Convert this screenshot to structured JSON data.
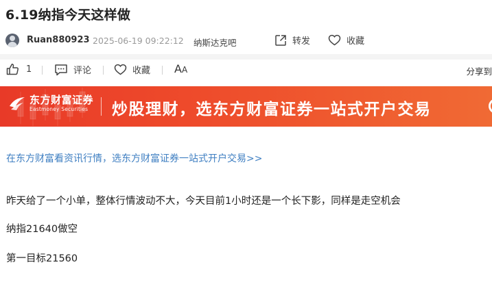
{
  "article": {
    "title": "6.19纳指今天这样做",
    "username": "Ruan880923",
    "datetime": "2025-06-19 09:22:12",
    "forum": "纳斯达克吧",
    "forward_label": "转发",
    "favorite_label": "收藏"
  },
  "toolbar": {
    "like_count": "1",
    "comment_label": "评论",
    "favorite_label": "收藏",
    "font_big": "A",
    "font_small": "A",
    "share_label": "分享到"
  },
  "banner": {
    "brand_cn": "东方财富证券",
    "brand_en": "Eastmoney Securities",
    "slogan": "炒股理财，选东方财富证券一站式开户交易"
  },
  "content": {
    "promo_link": "在东方财富看资讯行情，选东方财富证券一站式开户交易>>",
    "paragraphs": [
      "昨天给了一个小单，整体行情波动不大，今天目前1小时还是一个长下影，同样是走空机会",
      "纳指21640做空",
      "第一目标21560"
    ]
  },
  "icons": {
    "avatar": "user-avatar",
    "forward": "share-out-icon",
    "favorite": "heart-icon",
    "like": "thumbs-up-icon",
    "comment": "comment-icon",
    "font_size": "font-size-icon"
  },
  "colors": {
    "banner_start": "#e83a28",
    "banner_end": "#f06a34",
    "link": "#3f7fc2"
  }
}
